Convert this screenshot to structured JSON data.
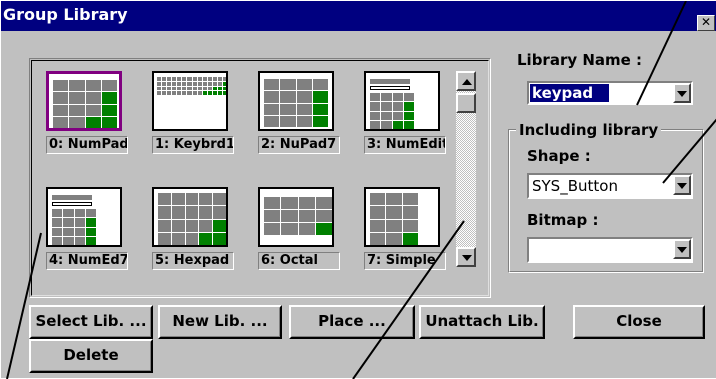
{
  "window": {
    "title": "Group Library",
    "close_glyph": "✕"
  },
  "tiles": [
    {
      "label": "0: NumPad"
    },
    {
      "label": "1: Keybrd1"
    },
    {
      "label": "2: NuPad7"
    },
    {
      "label": "3: NumEdit"
    },
    {
      "label": "4: NumEd7"
    },
    {
      "label": "5: Hexpad"
    },
    {
      "label": "6: Octal"
    },
    {
      "label": "7: Simple"
    }
  ],
  "library_name": {
    "label": "Library  Name :",
    "value": "keypad"
  },
  "including": {
    "title": "Including library",
    "shape_label": "Shape :",
    "shape_value": "SYS_Button",
    "bitmap_label": "Bitmap :",
    "bitmap_value": ""
  },
  "buttons": {
    "select": "Select Lib. ...",
    "new": "New Lib. ...",
    "place": "Place ...",
    "unattach": "Unattach Lib.",
    "close": "Close",
    "delete": "Delete"
  },
  "colors": {
    "titlebar": "#000080",
    "face": "#c0c0c0",
    "key_gray": "#808080",
    "key_green": "#008000",
    "selection": "#800080"
  }
}
